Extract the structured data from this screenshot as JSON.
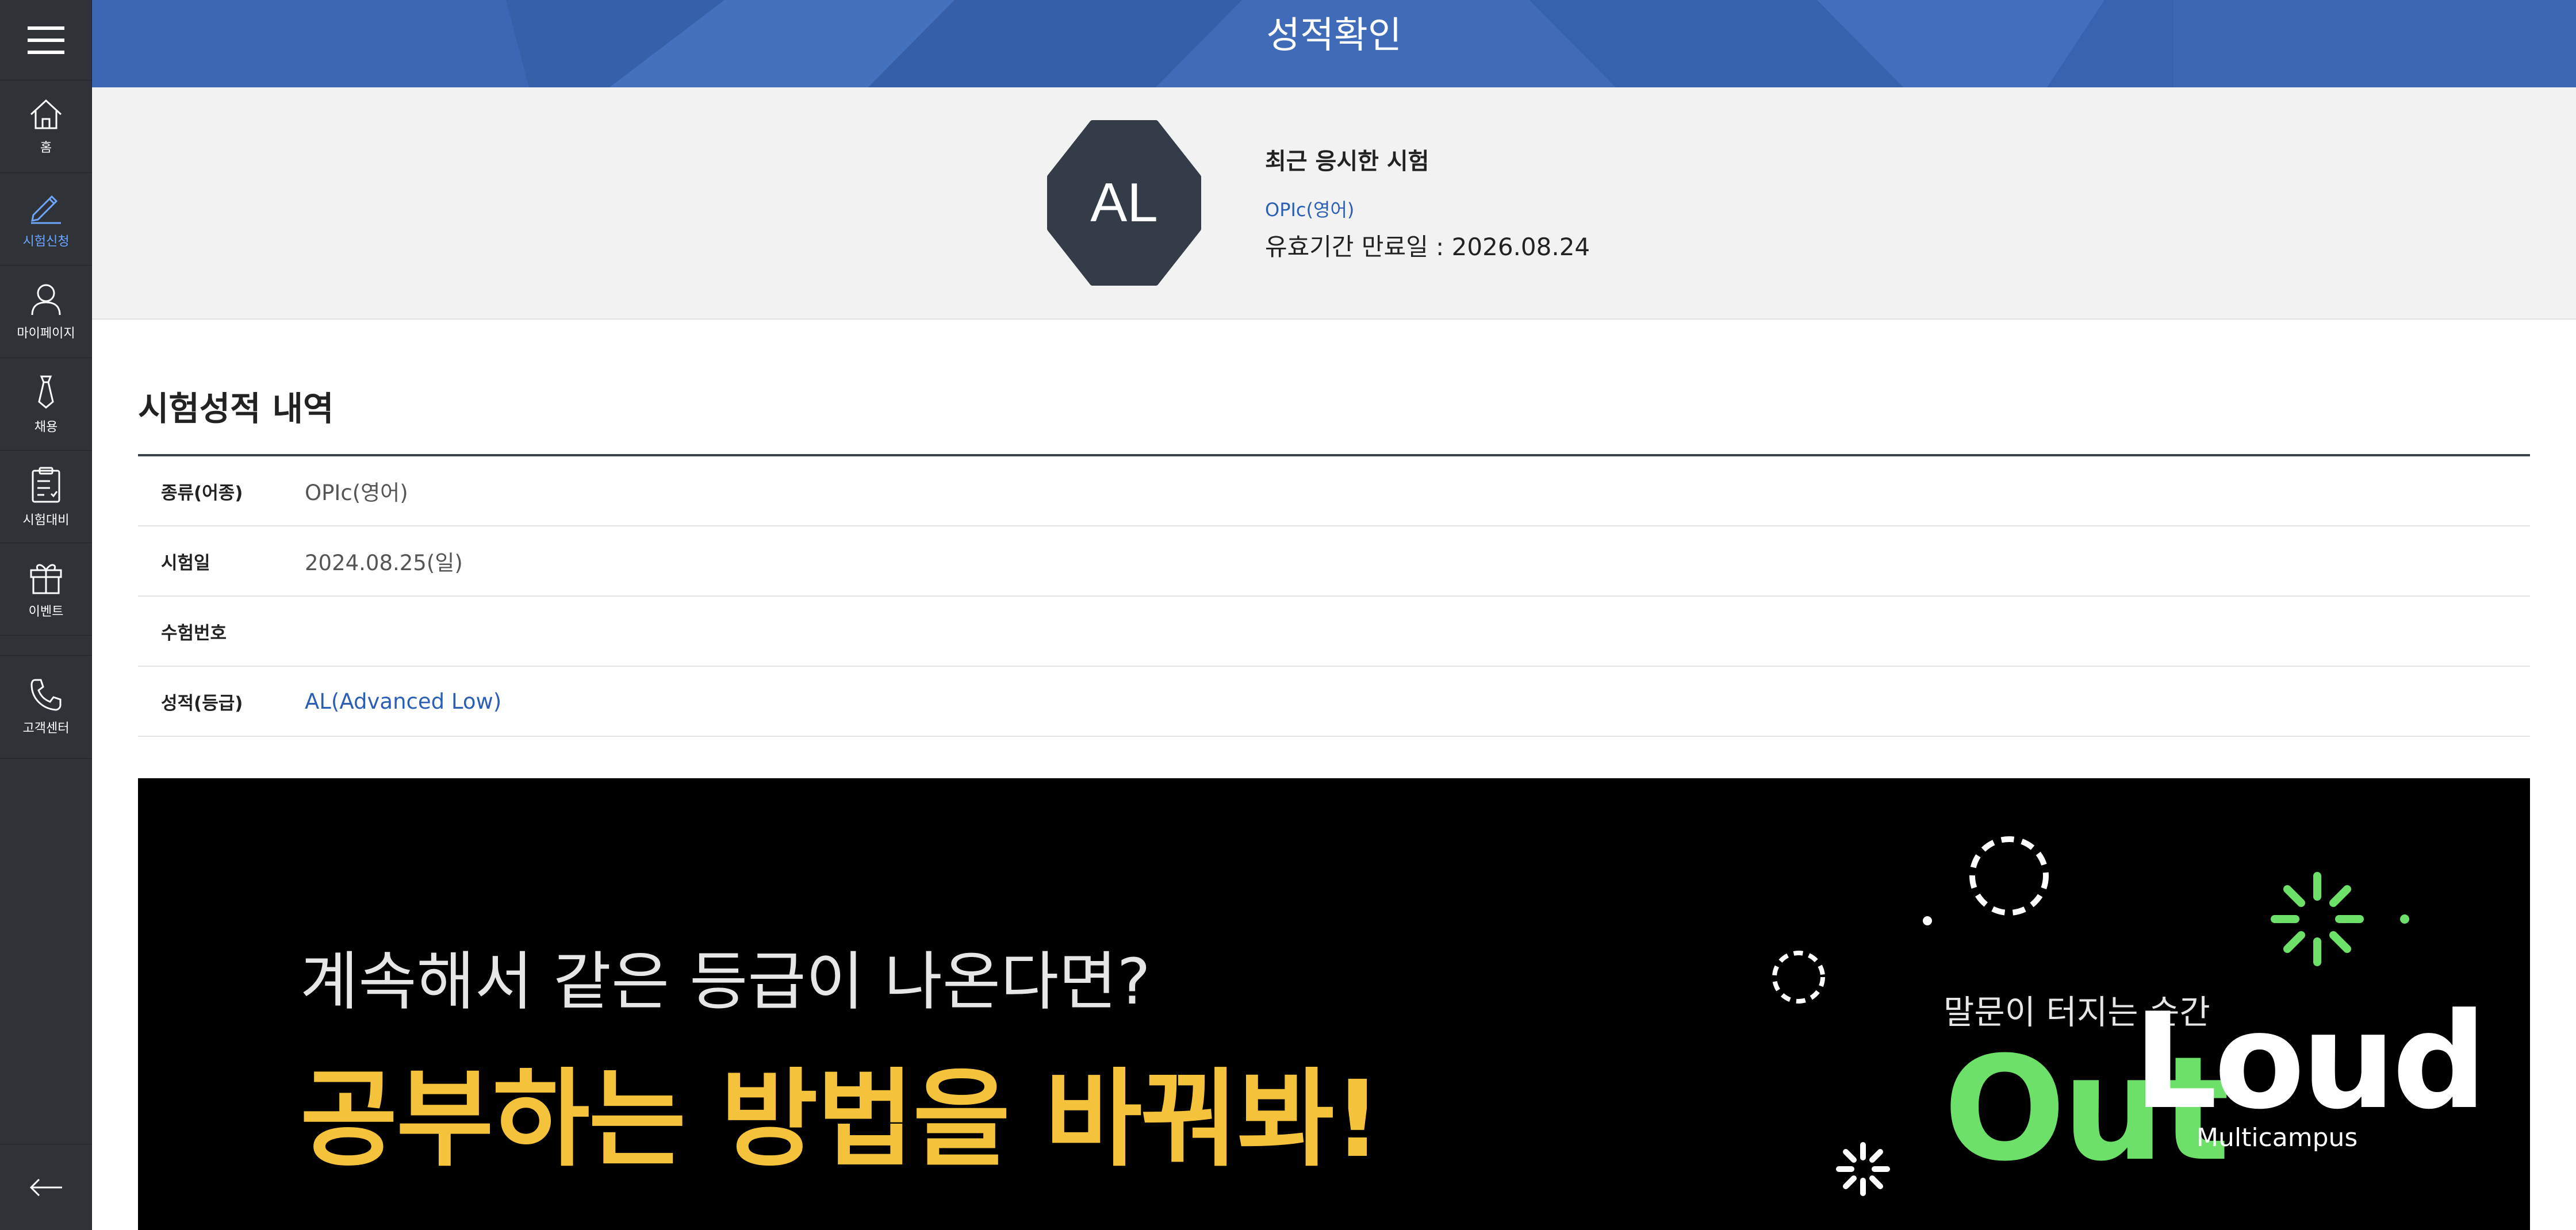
{
  "header": {
    "title": "성적확인"
  },
  "sidebar": {
    "items": [
      {
        "label": "홈",
        "icon": "home-icon"
      },
      {
        "label": "시험신청",
        "icon": "pencil-icon",
        "active": true
      },
      {
        "label": "마이페이지",
        "icon": "user-icon"
      },
      {
        "label": "채용",
        "icon": "tie-icon"
      },
      {
        "label": "시험대비",
        "icon": "clipboard-icon"
      },
      {
        "label": "이벤트",
        "icon": "gift-icon"
      },
      {
        "label": "고객센터",
        "icon": "phone-icon"
      }
    ],
    "accent": "#6ea6ff"
  },
  "recent": {
    "badge": "AL",
    "title": "최근 응시한 시험",
    "exam": "OPIc(영어)",
    "expiry": "유효기간 만료일 : 2026.08.24"
  },
  "history": {
    "title": "시험성적 내역",
    "rows": [
      {
        "label": "종류(어종)",
        "value": "OPIc(영어)"
      },
      {
        "label": "시험일",
        "value": "2024.08.25(일)"
      },
      {
        "label": "수험번호",
        "value": ""
      },
      {
        "label": "성적(등급)",
        "value": "AL(Advanced Low)"
      }
    ]
  },
  "promo": {
    "subtitle": "계속해서 같은 등급이 나온다면?",
    "headline": "공부하는 방법을 바꿔봐!",
    "tagline": "말문이 터지는 순간",
    "logo_out": "Out",
    "logo_loud": "Loud",
    "logo_brand": "Multicampus"
  },
  "colors": {
    "header_bg": "#3b67b4",
    "sidebar_bg": "#2f3338",
    "link": "#2b5fb6",
    "promo_headline": "#f4c23b",
    "logo_green": "#6de06a"
  }
}
